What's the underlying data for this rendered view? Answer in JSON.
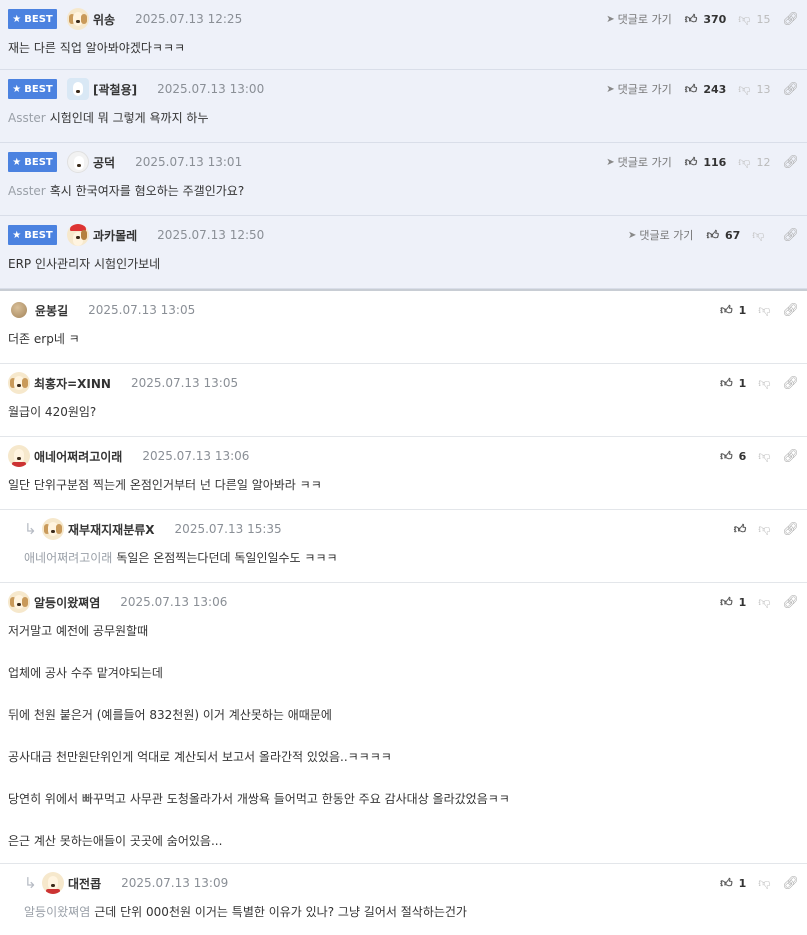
{
  "best_badge": "BEST",
  "goto_label": "댓글로 가기",
  "best_comments": [
    {
      "nick": "위송",
      "date": "2025.07.13 12:25",
      "mention": "",
      "text": "재는 다른 직업 알아봐야겠다ㅋㅋㅋ",
      "up": "370",
      "down": "15",
      "avatar": "dog"
    },
    {
      "nick": "[곽철용]",
      "date": "2025.07.13 13:00",
      "mention": "Asster",
      "text": "시험인데 뭐 그렇게 욕까지 하누",
      "up": "243",
      "down": "13",
      "avatar": "husky"
    },
    {
      "nick": "공덕",
      "date": "2025.07.13 13:01",
      "mention": "Asster",
      "text": "혹시 한국여자를 혐오하는 주갤인가요?",
      "up": "116",
      "down": "12",
      "avatar": "white"
    },
    {
      "nick": "과카몰레",
      "date": "2025.07.13 12:50",
      "mention": "",
      "text": "ERP 인사관리자 시험인가보네",
      "up": "67",
      "down": "",
      "avatar": "santa"
    }
  ],
  "comments": [
    {
      "nick": "윤봉길",
      "date": "2025.07.13 13:05",
      "text": "더존 erp네 ㅋ",
      "up": "1"
    },
    {
      "nick": "최홍자=XINN",
      "date": "2025.07.13 13:05",
      "text": "월급이 420원임?",
      "up": "1"
    },
    {
      "nick": "애네어쩌려고이래",
      "date": "2025.07.13 13:06",
      "text": "일단 단위구분점 찍는게 온점인거부터 넌 다른일 알아봐라 ㅋㅋ",
      "up": "6"
    },
    {
      "nick": "재부재지재분류X",
      "date": "2025.07.13 15:35",
      "mention": "애네어쩌려고이래",
      "text": "독일은 온점찍는다던데 독일인일수도 ㅋㅋㅋ",
      "up": ""
    },
    {
      "nick": "알등이왔쪄염",
      "date": "2025.07.13 13:06",
      "up": "1",
      "paragraphs": [
        "저거말고 예전에 공무원할때",
        "업체에 공사 수주 맡겨야되는데",
        "뒤에 천원 붙은거 (예를들어 832천원) 이거 계산못하는 애때문에",
        "공사대금 천만원단위인게 억대로 계산되서 보고서 올라간적 있었음..ㅋㅋㅋㅋ",
        "당연히 위에서 빠꾸먹고 사무관 도청올라가서 개쌍욕 들어먹고 한동안 주요 감사대상 올라갔었음ㅋㅋ",
        "은근 계산 못하는애들이 곳곳에 숨어있음..."
      ]
    },
    {
      "nick": "대전콥",
      "date": "2025.07.13 13:09",
      "mention": "알등이왔쪄염",
      "text": "근데 단위 000천원 이거는 특별한 이유가 있나? 그냥 길어서 절삭하는건가",
      "up": "1"
    }
  ]
}
